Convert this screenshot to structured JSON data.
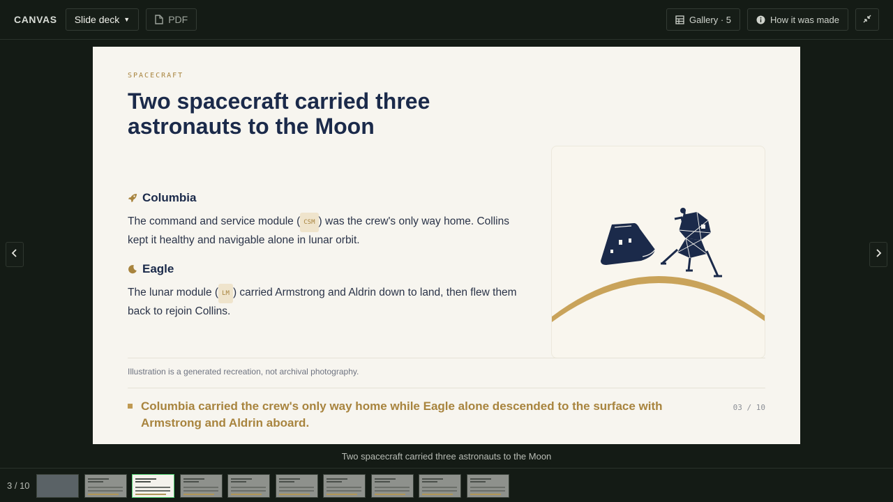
{
  "topbar": {
    "brand": "CANVAS",
    "view_select": "Slide deck",
    "pdf_label": "PDF",
    "gallery_label": "Gallery · 5",
    "how_made_label": "How it was made"
  },
  "slide": {
    "eyebrow": "SPACECRAFT",
    "title": "Two spacecraft carried three astronauts to the Moon",
    "sections": [
      {
        "icon": "rocket-icon",
        "heading": "Columbia",
        "body_before": "The command and service module (",
        "code": "CSM",
        "body_after": ") was the crew's only way home. Collins kept it healthy and navigable alone in lunar orbit."
      },
      {
        "icon": "moon-icon",
        "heading": "Eagle",
        "body_before": "The lunar module (",
        "code": "LM",
        "body_after": ") carried Armstrong and Aldrin down to land, then flew them back to rejoin Collins."
      }
    ],
    "caption": "Illustration is a generated recreation, not archival photography.",
    "takeaway": "Columbia carried the crew's only way home while Eagle alone descended to the surface with Armstrong and Aldrin aboard.",
    "page": "03 / 10",
    "colors": {
      "navy": "#1b2a4a",
      "gold": "#a8843e",
      "moon_arc": "#c9a35a"
    }
  },
  "slide_caption": "Two spacecraft carried three astronauts to the Moon",
  "filmstrip": {
    "counter": "3 / 10",
    "active_index": 2,
    "thumb_count": 10
  }
}
